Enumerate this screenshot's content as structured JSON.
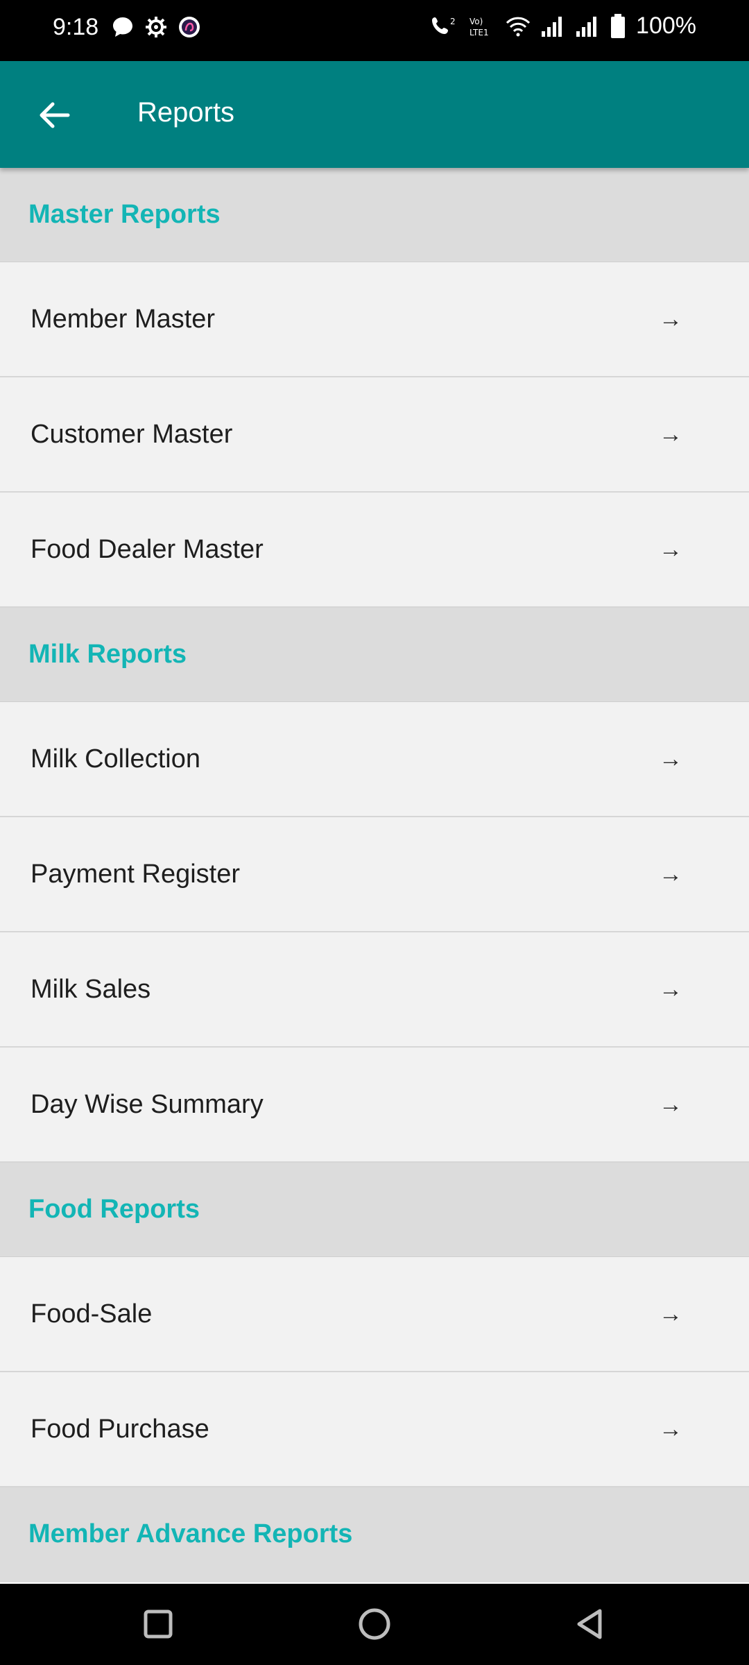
{
  "status_bar": {
    "time": "9:18",
    "battery": "100%",
    "icons": [
      "message-icon",
      "gear-icon",
      "app-icon",
      "call-icon",
      "volte-icon",
      "wifi-icon",
      "signal-icon",
      "signal-icon-2",
      "battery-icon"
    ]
  },
  "app_bar": {
    "title": "Reports",
    "back_icon": "arrow-left-icon"
  },
  "sections": [
    {
      "title": "Master Reports",
      "items": [
        "Member Master",
        "Customer Master",
        "Food Dealer Master"
      ]
    },
    {
      "title": "Milk Reports",
      "items": [
        "Milk Collection",
        "Payment Register",
        "Milk Sales",
        "Day Wise Summary"
      ]
    },
    {
      "title": "Food Reports",
      "items": [
        "Food-Sale",
        "Food Purchase"
      ]
    },
    {
      "title": "Member Advance Reports",
      "items": []
    }
  ],
  "item_arrow": "→",
  "colors": {
    "app_bar": "#008080",
    "section_title": "#13b5b5",
    "section_bg": "#dcdcdc",
    "item_bg": "#f2f2f2"
  },
  "nav_bar": {
    "buttons": [
      "recents-icon",
      "home-icon",
      "back-icon"
    ]
  }
}
